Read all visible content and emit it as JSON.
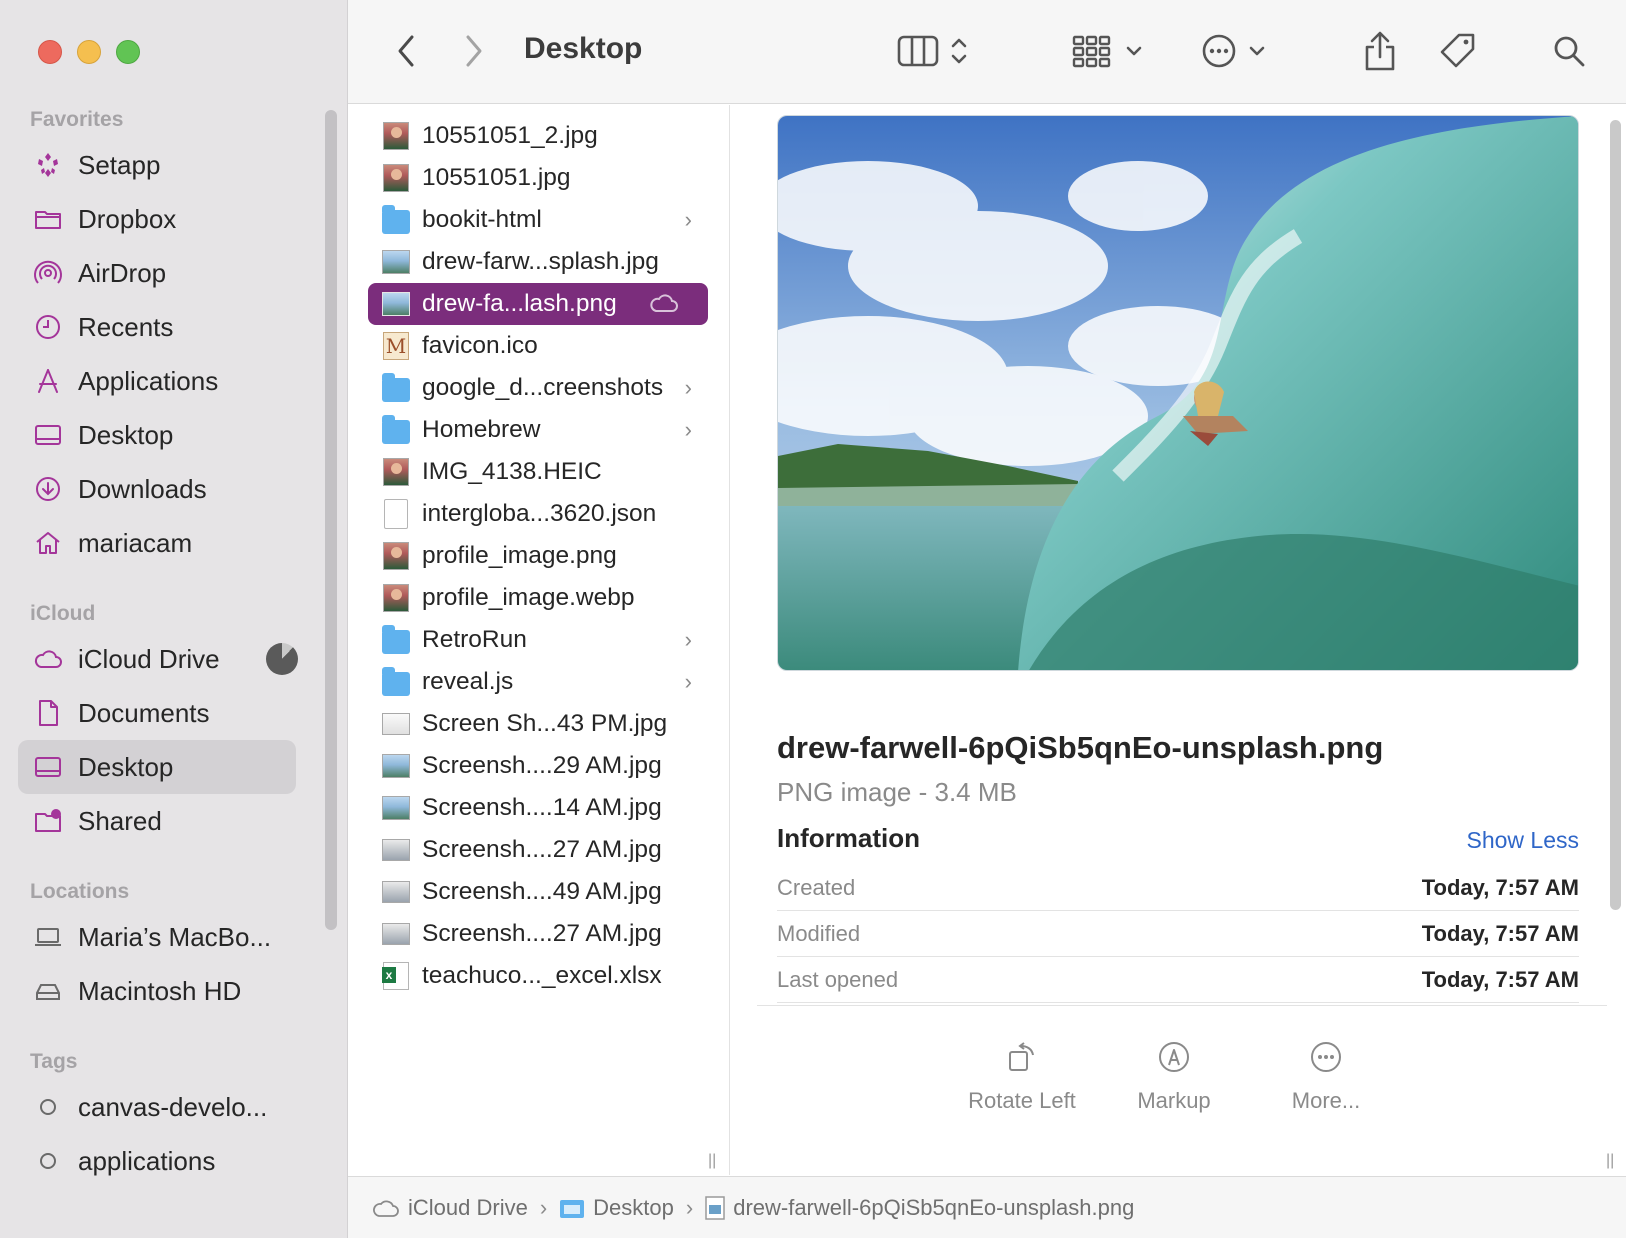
{
  "toolbar": {
    "title": "Desktop",
    "back_icon": "chevron-left-icon",
    "forward_icon": "chevron-right-icon",
    "view_icon": "column-view-icon",
    "group_icon": "grid-group-icon",
    "action_icon": "ellipsis-circle-icon",
    "share_icon": "share-icon",
    "tag_icon": "tag-icon",
    "search_icon": "search-icon"
  },
  "sidebar": {
    "sections": {
      "favorites": "Favorites",
      "icloud": "iCloud",
      "locations": "Locations",
      "tags": "Tags"
    },
    "favorites": [
      {
        "label": "Setapp",
        "icon": "setapp-icon"
      },
      {
        "label": "Dropbox",
        "icon": "folder-icon"
      },
      {
        "label": "AirDrop",
        "icon": "airdrop-icon"
      },
      {
        "label": "Recents",
        "icon": "clock-icon"
      },
      {
        "label": "Applications",
        "icon": "applications-icon"
      },
      {
        "label": "Desktop",
        "icon": "desktop-icon"
      },
      {
        "label": "Downloads",
        "icon": "download-icon"
      },
      {
        "label": "mariacam",
        "icon": "home-icon"
      }
    ],
    "icloud": [
      {
        "label": "iCloud Drive",
        "icon": "cloud-icon"
      },
      {
        "label": "Documents",
        "icon": "document-icon"
      },
      {
        "label": "Desktop",
        "icon": "desktop-icon",
        "selected": true
      },
      {
        "label": "Shared",
        "icon": "shared-folder-icon"
      }
    ],
    "locations": [
      {
        "label": "Maria’s MacBo...",
        "icon": "laptop-icon"
      },
      {
        "label": "Macintosh HD",
        "icon": "disk-icon"
      }
    ],
    "tags": [
      {
        "label": "canvas-develo...",
        "icon": "tag-circle-icon"
      },
      {
        "label": "applications",
        "icon": "tag-circle-icon"
      }
    ]
  },
  "files": [
    {
      "name": "10551051_2.jpg",
      "kind": "photo"
    },
    {
      "name": "10551051.jpg",
      "kind": "photo"
    },
    {
      "name": "bookit-html",
      "kind": "folder"
    },
    {
      "name": "drew-farw...splash.jpg",
      "kind": "landscape"
    },
    {
      "name": "drew-fa...lash.png",
      "kind": "landscape",
      "selected": true,
      "cloud": true
    },
    {
      "name": "favicon.ico",
      "kind": "ico"
    },
    {
      "name": "google_d...creenshots",
      "kind": "folder"
    },
    {
      "name": "Homebrew",
      "kind": "folder"
    },
    {
      "name": "IMG_4138.HEIC",
      "kind": "photo"
    },
    {
      "name": "intergloba...3620.json",
      "kind": "doc"
    },
    {
      "name": "profile_image.png",
      "kind": "photo"
    },
    {
      "name": "profile_image.webp",
      "kind": "photo"
    },
    {
      "name": "RetroRun",
      "kind": "folder"
    },
    {
      "name": "reveal.js",
      "kind": "folder"
    },
    {
      "name": "Screen Sh...43 PM.jpg",
      "kind": "screenshot"
    },
    {
      "name": "Screensh....29 AM.jpg",
      "kind": "landscape"
    },
    {
      "name": "Screensh....14 AM.jpg",
      "kind": "landscape"
    },
    {
      "name": "Screensh....27 AM.jpg",
      "kind": "screenshot"
    },
    {
      "name": "Screensh....49 AM.jpg",
      "kind": "screenshot"
    },
    {
      "name": "Screensh....27 AM.jpg",
      "kind": "screenshot"
    },
    {
      "name": "teachuco..._excel.xlsx",
      "kind": "xlsx"
    }
  ],
  "preview": {
    "filename": "drew-farwell-6pQiSb5qnEo-unsplash.png",
    "kind_size": "PNG image - 3.4 MB",
    "info_heading": "Information",
    "show_less": "Show Less",
    "rows": [
      {
        "key": "Created",
        "value": "Today, 7:57 AM"
      },
      {
        "key": "Modified",
        "value": "Today, 7:57 AM"
      },
      {
        "key": "Last opened",
        "value": "Today, 7:57 AM"
      }
    ],
    "actions": [
      {
        "label": "Rotate Left",
        "icon": "rotate-left-icon"
      },
      {
        "label": "Markup",
        "icon": "markup-icon"
      },
      {
        "label": "More...",
        "icon": "ellipsis-circle-icon"
      }
    ]
  },
  "pathbar": {
    "segments": [
      "iCloud Drive",
      "Desktop",
      "drew-farwell-6pQiSb5qnEo-unsplash.png"
    ]
  },
  "colors": {
    "accent": "#7b2d7c",
    "sidebar_icon": "#a4359a",
    "link": "#2f66c8"
  }
}
